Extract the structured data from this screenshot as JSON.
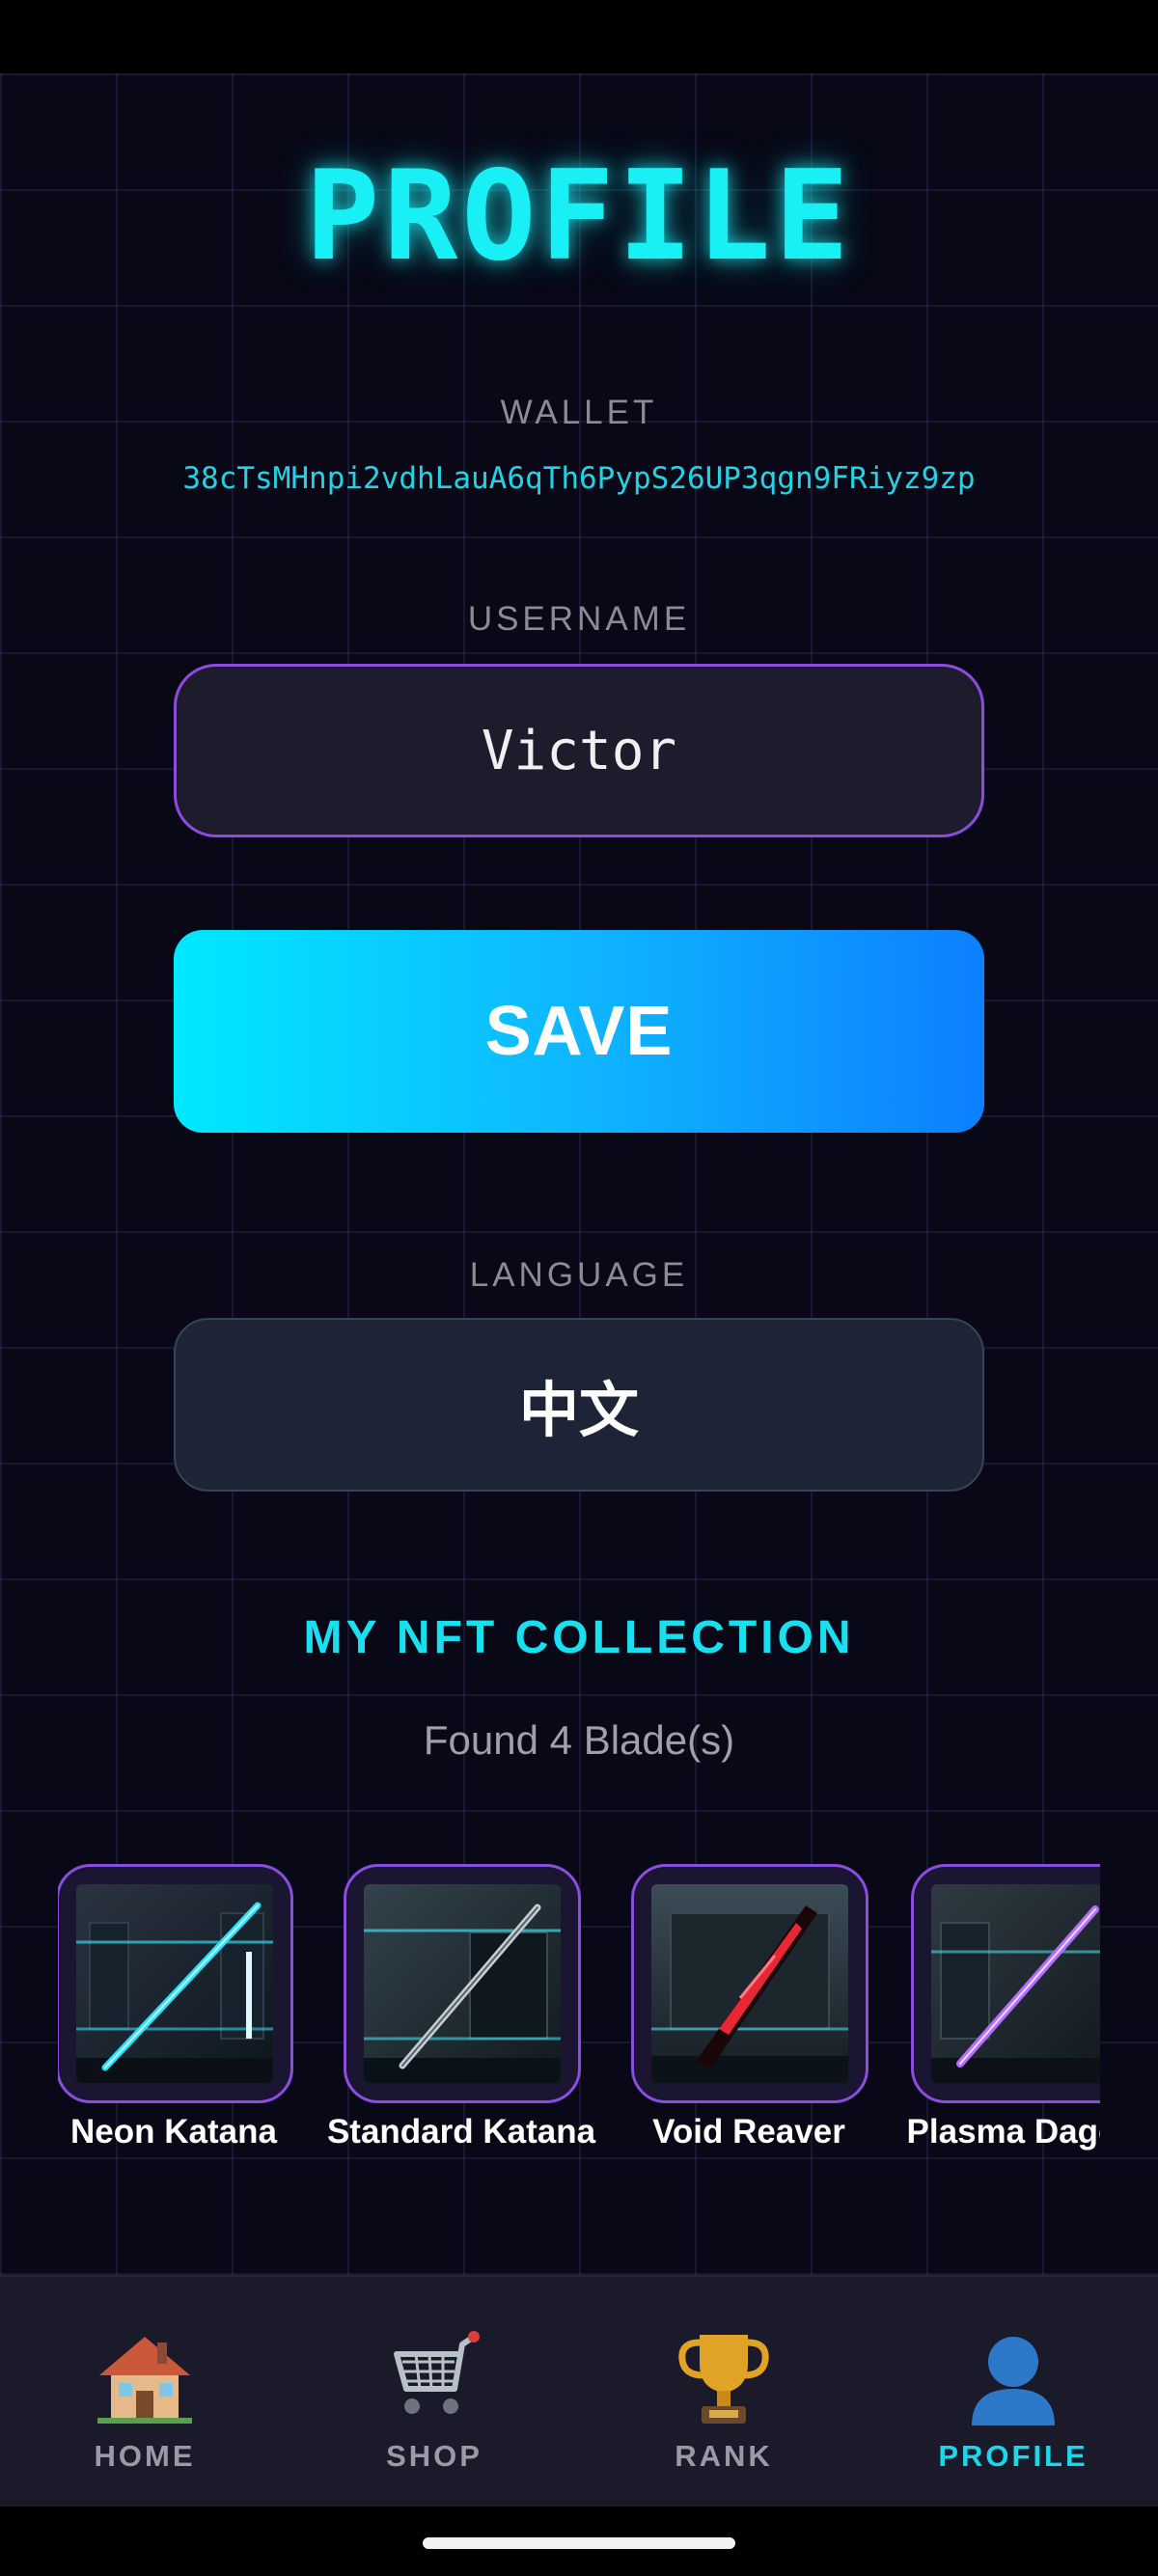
{
  "header": {
    "title": "PROFILE"
  },
  "wallet": {
    "label": "WALLET",
    "address": "38cTsMHnpi2vdhLauA6qTh6PypS26UP3qgn9FRiyz9zp"
  },
  "username": {
    "label": "USERNAME",
    "value": "Victor"
  },
  "save": {
    "label": "SAVE"
  },
  "language": {
    "label": "LANGUAGE",
    "value": "中文"
  },
  "nft": {
    "title": "MY NFT COLLECTION",
    "count_text": "Found 4 Blade(s)",
    "items": [
      {
        "name": "Neon Katana",
        "blade_color": "#22e4ff"
      },
      {
        "name": "Standard Katana",
        "blade_color": "#c8ccd4"
      },
      {
        "name": "Void Reaver",
        "blade_color": "#ff2a3a"
      },
      {
        "name": "Plasma Dagger",
        "blade_color": "#b36cff"
      }
    ]
  },
  "nav": {
    "items": [
      {
        "label": "HOME",
        "icon": "house-icon",
        "active": false
      },
      {
        "label": "SHOP",
        "icon": "shopping-cart-icon",
        "active": false
      },
      {
        "label": "RANK",
        "icon": "trophy-icon",
        "active": false
      },
      {
        "label": "PROFILE",
        "icon": "user-icon",
        "active": true
      }
    ]
  },
  "colors": {
    "accent_cyan": "#18f0f5",
    "accent_purple": "#8a4de0",
    "nav_active": "#18d8ea"
  }
}
